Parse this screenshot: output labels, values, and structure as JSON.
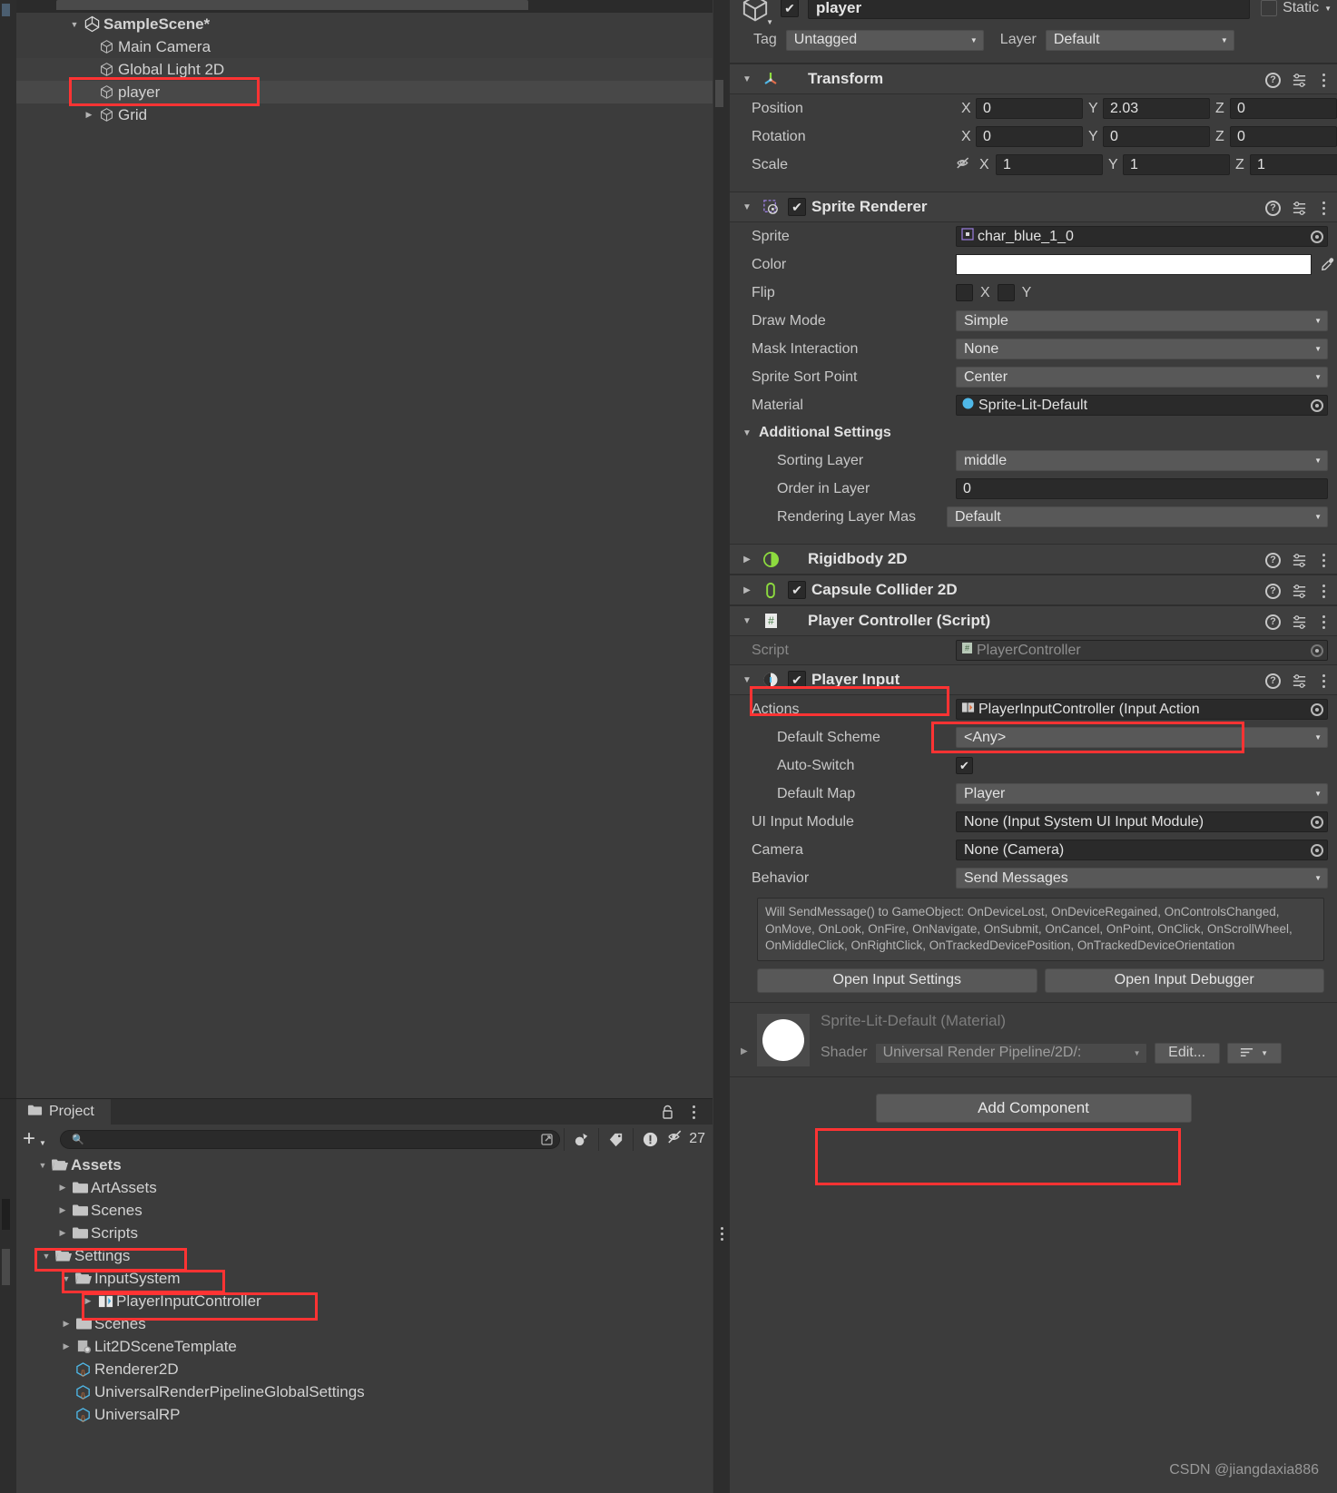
{
  "hierarchy": {
    "rows": [
      {
        "label": "SampleScene*",
        "icon": "unity-scene-icon",
        "indent": 0,
        "twisty": "down",
        "bold": true,
        "selected": false
      },
      {
        "label": "Main Camera",
        "icon": "gameobject-cube-icon",
        "indent": 1,
        "twisty": "",
        "bold": false,
        "selected": false
      },
      {
        "label": "Global Light 2D",
        "icon": "gameobject-cube-icon",
        "indent": 1,
        "twisty": "",
        "bold": false,
        "selected": false
      },
      {
        "label": "player",
        "icon": "gameobject-cube-icon",
        "indent": 1,
        "twisty": "",
        "bold": false,
        "selected": true
      },
      {
        "label": "Grid",
        "icon": "gameobject-cube-icon",
        "indent": 1,
        "twisty": "right",
        "bold": false,
        "selected": false
      }
    ]
  },
  "project": {
    "tab_label": "Project",
    "search_value": "",
    "search_placeholder": "",
    "asset_count": "27",
    "rows": [
      {
        "label": "Assets",
        "icon": "folder-open-icon",
        "indent": 0,
        "twisty": "down",
        "bold": true
      },
      {
        "label": "ArtAssets",
        "icon": "folder-icon",
        "indent": 1,
        "twisty": "right",
        "bold": false
      },
      {
        "label": "Scenes",
        "icon": "folder-icon",
        "indent": 1,
        "twisty": "right",
        "bold": false
      },
      {
        "label": "Scripts",
        "icon": "folder-icon",
        "indent": 1,
        "twisty": "right",
        "bold": false
      },
      {
        "label": "Settings",
        "icon": "folder-open-icon",
        "indent": 1,
        "twisty": "down",
        "bold": false
      },
      {
        "label": "InputSystem",
        "icon": "folder-open-icon",
        "indent": 2,
        "twisty": "down",
        "bold": false
      },
      {
        "label": "PlayerInputController",
        "icon": "input-actions-asset-icon",
        "indent": 3,
        "twisty": "right",
        "bold": false
      },
      {
        "label": "Scenes",
        "icon": "folder-icon",
        "indent": 2,
        "twisty": "right",
        "bold": false
      },
      {
        "label": "Lit2DSceneTemplate",
        "icon": "scene-template-icon",
        "indent": 2,
        "twisty": "right",
        "bold": false
      },
      {
        "label": "Renderer2D",
        "icon": "scriptable-object-icon",
        "indent": 2,
        "twisty": "",
        "bold": false
      },
      {
        "label": "UniversalRenderPipelineGlobalSettings",
        "icon": "scriptable-object-icon",
        "indent": 2,
        "twisty": "",
        "bold": false
      },
      {
        "label": "UniversalRP",
        "icon": "scriptable-object-icon",
        "indent": 2,
        "twisty": "",
        "bold": false
      }
    ]
  },
  "inspector": {
    "gameobject": {
      "enabled": true,
      "name": "player",
      "static_label": "Static",
      "static_checked": false,
      "tag_label": "Tag",
      "tag_value": "Untagged",
      "layer_label": "Layer",
      "layer_value": "Default"
    },
    "transform": {
      "title": "Transform",
      "expanded": true,
      "rows": [
        {
          "label": "Position",
          "x": "0",
          "y": "2.03",
          "z": "0"
        },
        {
          "label": "Rotation",
          "x": "0",
          "y": "0",
          "z": "0"
        },
        {
          "label": "Scale",
          "x": "1",
          "y": "1",
          "z": "1"
        }
      ],
      "axis_labels": [
        "X",
        "Y",
        "Z"
      ]
    },
    "sprite_renderer": {
      "title": "Sprite Renderer",
      "enabled": true,
      "sprite_label": "Sprite",
      "sprite_value": "char_blue_1_0",
      "color_label": "Color",
      "color_value": "#FFFFFF",
      "flip_label": "Flip",
      "flip_x_label": "X",
      "flip_y_label": "Y",
      "draw_mode_label": "Draw Mode",
      "draw_mode_value": "Simple",
      "mask_interaction_label": "Mask Interaction",
      "mask_interaction_value": "None",
      "sort_point_label": "Sprite Sort Point",
      "sort_point_value": "Center",
      "material_label": "Material",
      "material_value": "Sprite-Lit-Default",
      "additional_settings_label": "Additional Settings",
      "sorting_layer_label": "Sorting Layer",
      "sorting_layer_value": "middle",
      "order_in_layer_label": "Order in Layer",
      "order_in_layer_value": "0",
      "rendering_layer_label": "Rendering Layer Mas",
      "rendering_layer_value": "Default"
    },
    "rigidbody2d": {
      "title": "Rigidbody 2D",
      "expanded": false
    },
    "capsule_collider2d": {
      "title": "Capsule Collider 2D",
      "expanded": false,
      "enabled": true
    },
    "player_controller": {
      "title": "Player Controller (Script)",
      "script_label": "Script",
      "script_value": "PlayerController"
    },
    "player_input": {
      "title": "Player Input",
      "enabled": true,
      "actions_label": "Actions",
      "actions_value": "PlayerInputController (Input Action",
      "default_scheme_label": "Default Scheme",
      "default_scheme_value": "<Any>",
      "auto_switch_label": "Auto-Switch",
      "auto_switch_checked": true,
      "default_map_label": "Default Map",
      "default_map_value": "Player",
      "ui_input_module_label": "UI Input Module",
      "ui_input_module_value": "None (Input System UI Input Module)",
      "camera_label": "Camera",
      "camera_value": "None (Camera)",
      "behavior_label": "Behavior",
      "behavior_value": "Send Messages",
      "help_text": "Will SendMessage() to GameObject: OnDeviceLost, OnDeviceRegained, OnControlsChanged, OnMove, OnLook, OnFire, OnNavigate, OnSubmit, OnCancel, OnPoint, OnClick, OnScrollWheel, OnMiddleClick, OnRightClick, OnTrackedDevicePosition, OnTrackedDeviceOrientation",
      "open_settings_label": "Open Input Settings",
      "open_debugger_label": "Open Input Debugger"
    },
    "material_preview": {
      "title": "Sprite-Lit-Default (Material)",
      "shader_label": "Shader",
      "shader_value": "Universal Render Pipeline/2D/:",
      "edit_label": "Edit...",
      "list_label": ""
    },
    "add_component_label": "Add Component"
  },
  "watermark": "CSDN @jiangdaxia886",
  "colors": {
    "annotation": "#ff3333",
    "panel_bg": "#3c3c3c",
    "window_bg": "#383838",
    "field_bg": "#2a2a2a",
    "dropdown_bg": "#585858",
    "accent_green": "#8ddb3f",
    "accent_blue": "#4fb8e8"
  }
}
